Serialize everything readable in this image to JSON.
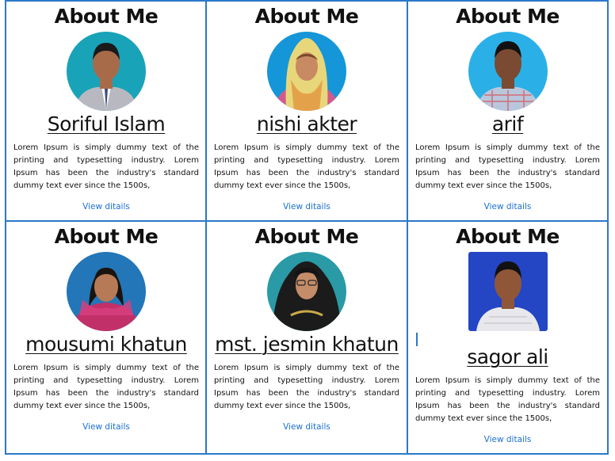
{
  "cards": [
    {
      "heading": "About Me",
      "name": "Soriful Islam",
      "description": "Lorem Ipsum is simply dummy text of the printing and typesetting industry. Lorem Ipsum has been the industry's standard dummy text ever since the 1500s,",
      "link": "View ditails",
      "photo": {
        "bg": "#19a3b8",
        "skin": "#a86b4a",
        "hair": "#1a1a1a",
        "cloth": "#b8b8c0"
      }
    },
    {
      "heading": "About Me",
      "name": "nishi akter",
      "description": "Lorem Ipsum is simply dummy text of the printing and typesetting industry. Lorem Ipsum has been the industry's standard dummy text ever since the 1500s,",
      "link": "View ditails",
      "photo": {
        "bg": "#1596d8",
        "skin": "#c88a62",
        "hair": "#e8d77a",
        "cloth": "#d05a8c"
      }
    },
    {
      "heading": "About Me",
      "name": "arif",
      "description": "Lorem Ipsum is simply dummy text of the printing and typesetting industry. Lorem Ipsum has been the industry's standard dummy text ever since the 1500s,",
      "link": "View ditails",
      "photo": {
        "bg": "#2ab0e6",
        "skin": "#7a4a32",
        "hair": "#111111",
        "cloth": "#b9c7dc"
      }
    },
    {
      "heading": "About Me",
      "name": "mousumi khatun",
      "description": "Lorem Ipsum is simply dummy text of the printing and typesetting industry. Lorem Ipsum has been the industry's standard dummy text ever since the 1500s,",
      "link": "View ditails",
      "photo": {
        "bg": "#2376b8",
        "skin": "#b77a56",
        "hair": "#1a1410",
        "cloth": "#c2306a"
      }
    },
    {
      "heading": "About Me",
      "name": "mst. jesmin khatun",
      "description": "Lorem Ipsum is simply dummy text of the printing and typesetting industry. Lorem Ipsum has been the industry's standard dummy text ever since the 1500s,",
      "link": "View ditails",
      "photo": {
        "bg": "#2a9aa6",
        "skin": "#c48c68",
        "hair": "#141414",
        "cloth": "#1b1b1b"
      }
    },
    {
      "heading": "About Me",
      "name": "sagor ali",
      "description": "Lorem Ipsum is simply dummy text of the printing and typesetting industry. Lorem Ipsum has been the industry's standard dummy text ever since the 1500s,",
      "link": "View ditails",
      "photo": {
        "bg": "#2445c4",
        "skin": "#8f5738",
        "hair": "#111111",
        "cloth": "#e8e8ec"
      }
    }
  ],
  "colors": {
    "border": "#2b79c9",
    "link": "#1b6fd0",
    "text": "#111111"
  }
}
